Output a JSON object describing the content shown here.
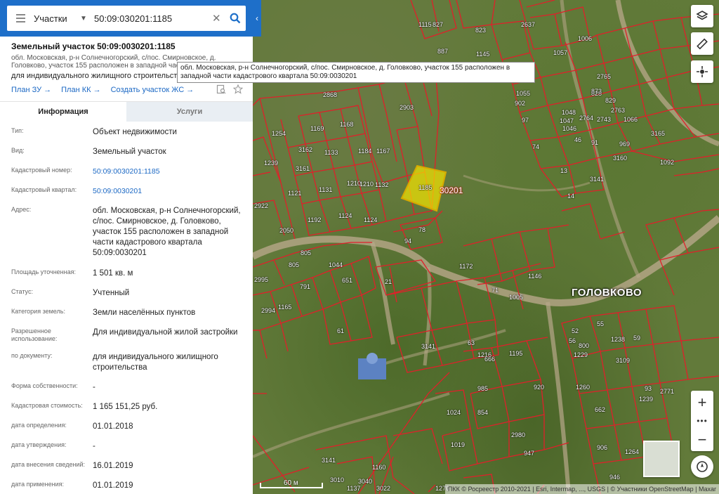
{
  "search": {
    "type": "Участки",
    "value": "50:09:030201:1185"
  },
  "object": {
    "title": "Земельный участок 50:09:0030201:1185",
    "address": "обл. Московская, р-н Солнечногорский, с/пос. Смирновское, д. Головково, участок 155 расположен в западной части кадастрового квартала 50:09:0030201",
    "purpose": "для индивидуального жилищного строительства",
    "links": [
      "План ЗУ →",
      "План КК →",
      "Создать участок ЖС →"
    ]
  },
  "tabs": [
    "Информация",
    "Услуги"
  ],
  "properties": [
    {
      "k": "Тип:",
      "v": "Объект недвижимости"
    },
    {
      "k": "Вид:",
      "v": "Земельный участок"
    },
    {
      "k": "Кадастровый номер:",
      "v": "50:09:0030201:1185",
      "link": true
    },
    {
      "k": "Кадастровый квартал:",
      "v": "50:09:0030201",
      "link": true
    },
    {
      "k": "Адрес:",
      "v": "обл. Московская, р-н Солнечногорский, с/пос. Смирновское, д. Головково, участок 155 расположен в западной части кадастрового квартала 50:09:0030201"
    },
    {
      "k": "Площадь уточненная:",
      "v": "1 501 кв. м"
    },
    {
      "k": "Статус:",
      "v": "Учтенный"
    },
    {
      "k": "Категория земель:",
      "v": "Земли населённых пунктов"
    },
    {
      "k": "Разрешенное использование:",
      "v": "Для индивидуальной жилой застройки"
    },
    {
      "k": "по документу:",
      "v": "для индивидуального жилищного строительства"
    },
    {
      "k": "Форма собственности:",
      "v": "-"
    },
    {
      "k": "Кадастровая стоимость:",
      "v": "1 165 151,25 руб."
    },
    {
      "k": "дата определения:",
      "v": "01.01.2018"
    },
    {
      "k": "дата утверждения:",
      "v": "-"
    },
    {
      "k": "дата внесения сведений:",
      "v": "16.01.2019"
    },
    {
      "k": "дата применения:",
      "v": "01.01.2019"
    }
  ],
  "tooltip": "обл. Московская, р-н Солнечногорский, с/пос. Смирновское, д. Головково, участок 155 расположен в западной части кадастрового квартала 50:09:0030201",
  "map": {
    "village": "ГОЛОВКОВО",
    "quarter": "30201",
    "selected_plot": "1185",
    "scale": "60 м",
    "attribution": "ПКК © Росреестр 2010-2021 | Esri, Intermap, ..., USGS | © Участники OpenStreetMap | Maxar",
    "plot_labels": [
      "2637",
      "1115",
      "827",
      "823",
      "887",
      "1145",
      "1057",
      "1006",
      "2765",
      "828",
      "1055",
      "902",
      "873",
      "829",
      "2763",
      "1048",
      "2764",
      "1047",
      "2743",
      "1066",
      "97",
      "1046",
      "46",
      "91",
      "969",
      "3165",
      "74",
      "3160",
      "1092",
      "13",
      "3141",
      "14",
      "2868",
      "1254",
      "1169",
      "1168",
      "2903",
      "1167",
      "3162",
      "1133",
      "1239",
      "3161",
      "1184",
      "1210",
      "1210",
      "1132",
      "1121",
      "1131",
      "1192",
      "1124",
      "1124",
      "2922",
      "2050",
      "78",
      "94",
      "805",
      "805",
      "1044",
      "651",
      "1172",
      "1146",
      "71",
      "1005",
      "21",
      "2995",
      "791",
      "2994",
      "1165",
      "61",
      "52",
      "55",
      "1238",
      "59",
      "56",
      "800",
      "1229",
      "3109",
      "3141",
      "63",
      "1216",
      "666",
      "1195",
      "985",
      "920",
      "1260",
      "93",
      "854",
      "662",
      "1239",
      "2771",
      "1024",
      "2980",
      "947",
      "906",
      "1019",
      "1264",
      "3141",
      "1160",
      "946",
      "3010",
      "3040",
      "1137",
      "3022",
      "1270"
    ],
    "colors": {
      "boundary": "#e0202a",
      "selected": "#f5e600",
      "panel_accent": "#1e6fc9"
    }
  },
  "controls": {
    "layers": "layers-icon",
    "ruler": "ruler-icon",
    "locate": "crosshair-icon",
    "zoom_in": "+",
    "zoom_more": "•••",
    "zoom_out": "−",
    "compass": "compass-icon"
  }
}
